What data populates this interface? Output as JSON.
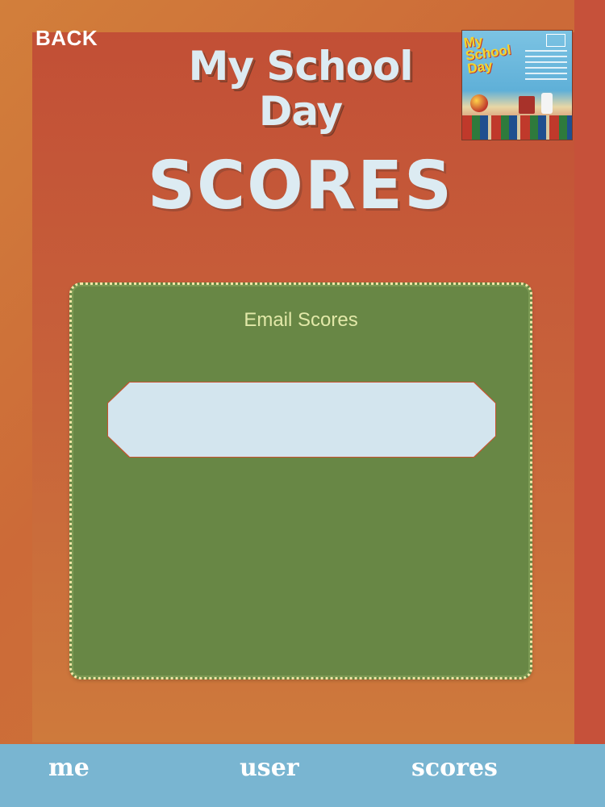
{
  "header": {
    "back_label": "BACK",
    "app_title": "My School Day",
    "page_heading": "SCORES"
  },
  "cover": {
    "title_line1": "My",
    "title_line2": "School",
    "title_line3": "Day"
  },
  "card": {
    "title": "Email Scores",
    "email_value": "",
    "email_placeholder": ""
  },
  "tabs": [
    {
      "label": "me"
    },
    {
      "label": "user"
    },
    {
      "label": "scores"
    }
  ],
  "colors": {
    "background_orange": "#cc6a38",
    "card_green": "#688745",
    "tab_bar_blue": "#79b5d1",
    "title_text": "#dcebf2"
  }
}
